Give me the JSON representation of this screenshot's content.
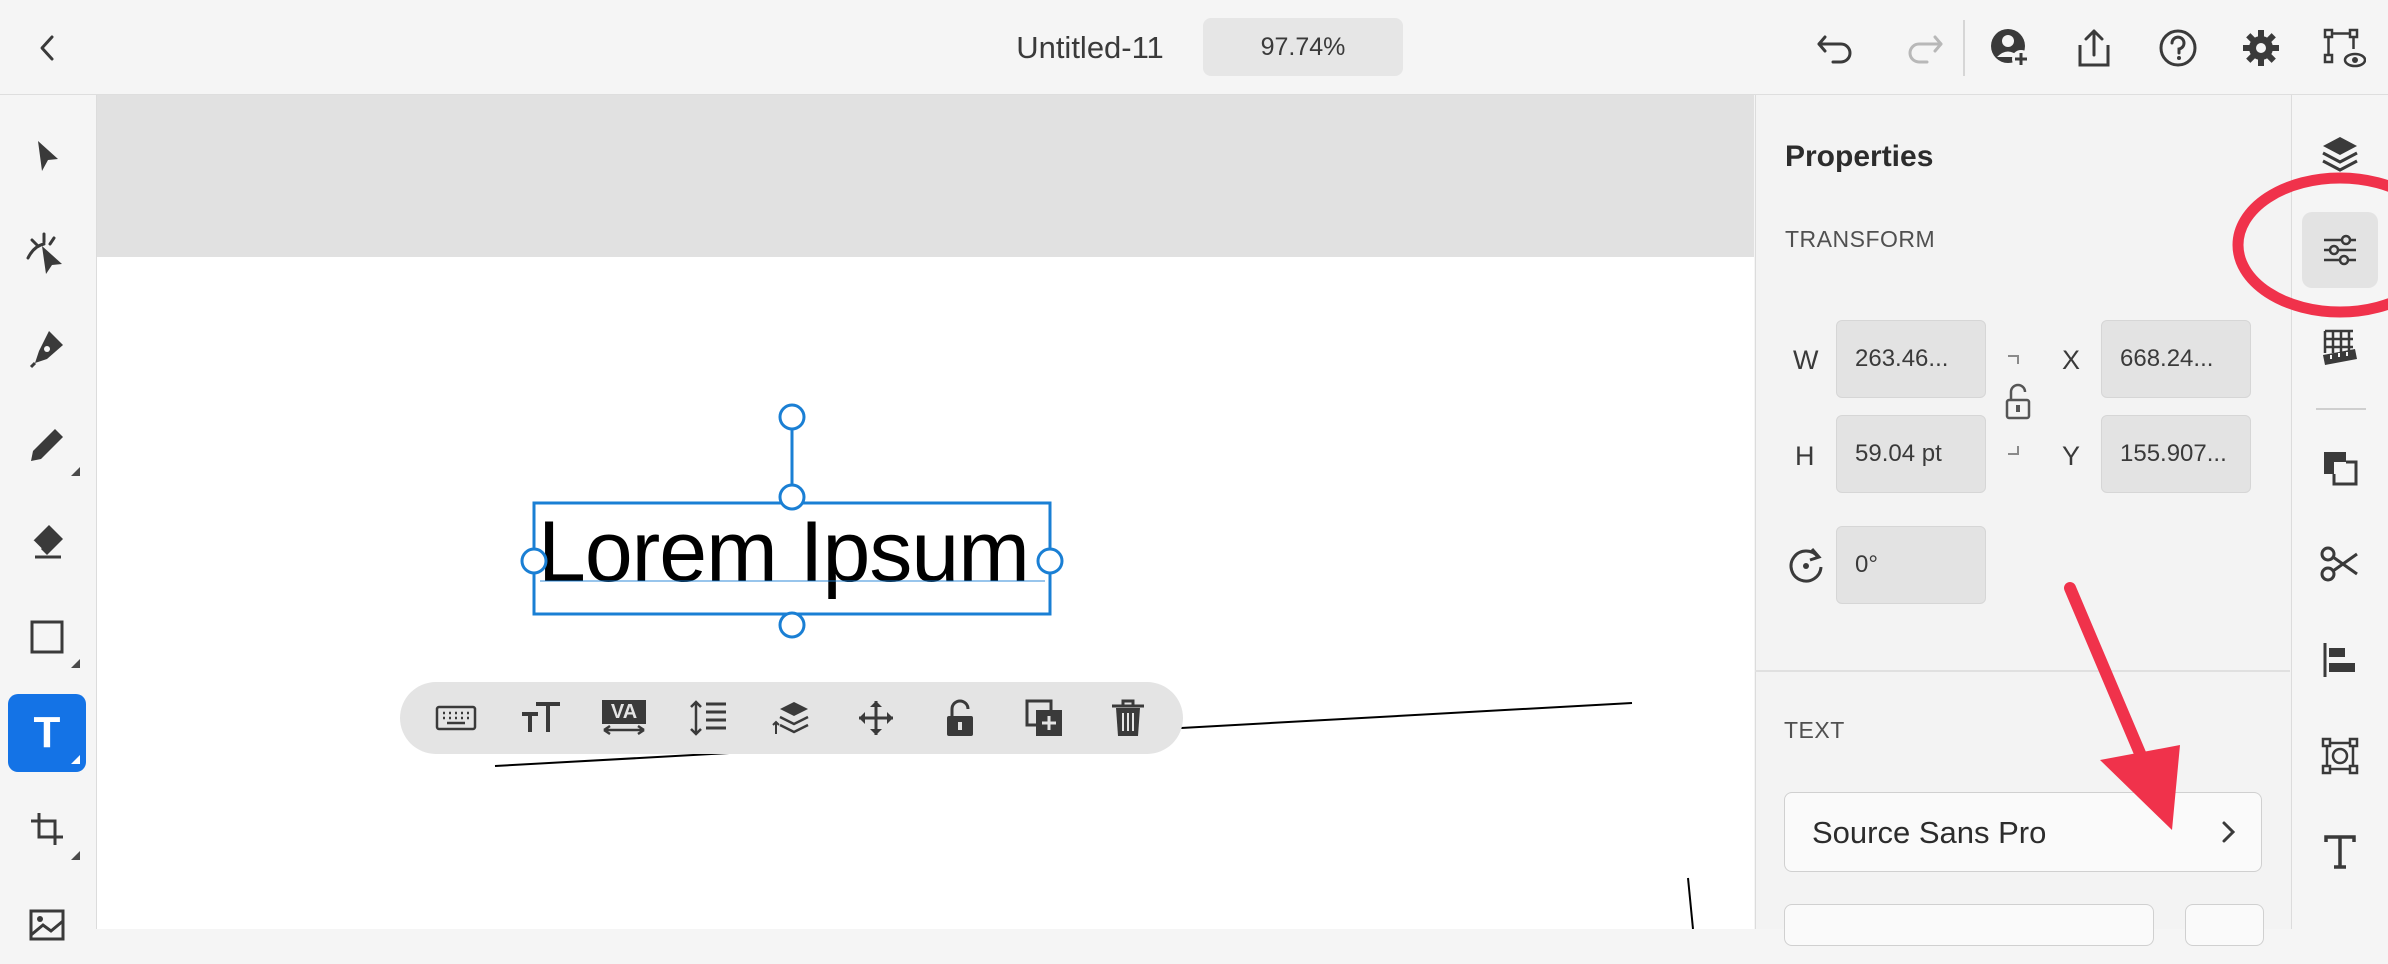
{
  "header": {
    "title": "Untitled-11",
    "zoom": "97.74%",
    "icons": [
      "back-icon",
      "undo-icon",
      "redo-icon",
      "invite-icon",
      "share-icon",
      "help-icon",
      "settings-icon",
      "prototype-icon"
    ]
  },
  "left_toolbar": {
    "tools": [
      "select-icon",
      "direct-select-icon",
      "pen-icon",
      "pencil-icon",
      "eraser-icon",
      "rectangle-icon",
      "text-icon",
      "crop-icon",
      "image-icon"
    ],
    "active": "text",
    "text_tool_letter": "T"
  },
  "canvas": {
    "text_object": "Lorem Ipsum"
  },
  "context_bar": {
    "tools": [
      "keyboard-icon",
      "text-size-icon",
      "kerning-icon",
      "line-spacing-icon",
      "arrange-icon",
      "move-icon",
      "lock-icon",
      "duplicate-icon",
      "delete-icon"
    ],
    "kerning_glyph": "VA"
  },
  "properties": {
    "title": "Properties",
    "transform_label": "TRANSFORM",
    "w_label": "W",
    "w_value": "263.46...",
    "h_label": "H",
    "h_value": "59.04 pt",
    "x_label": "X",
    "x_value": "668.24...",
    "y_label": "Y",
    "y_value": "155.907...",
    "rotation_value": "0°",
    "text_label": "TEXT",
    "font_family": "Source Sans Pro"
  },
  "right_strip": {
    "icons": [
      "layers-icon",
      "properties-icon",
      "grid-ruler-icon",
      "combine-icon",
      "scissors-icon",
      "align-icon",
      "transform-icon",
      "type-icon"
    ],
    "active": "properties-icon"
  },
  "colors": {
    "accent": "#1473e6",
    "annotation": "#f0324b",
    "selection": "#1a7fd4"
  }
}
